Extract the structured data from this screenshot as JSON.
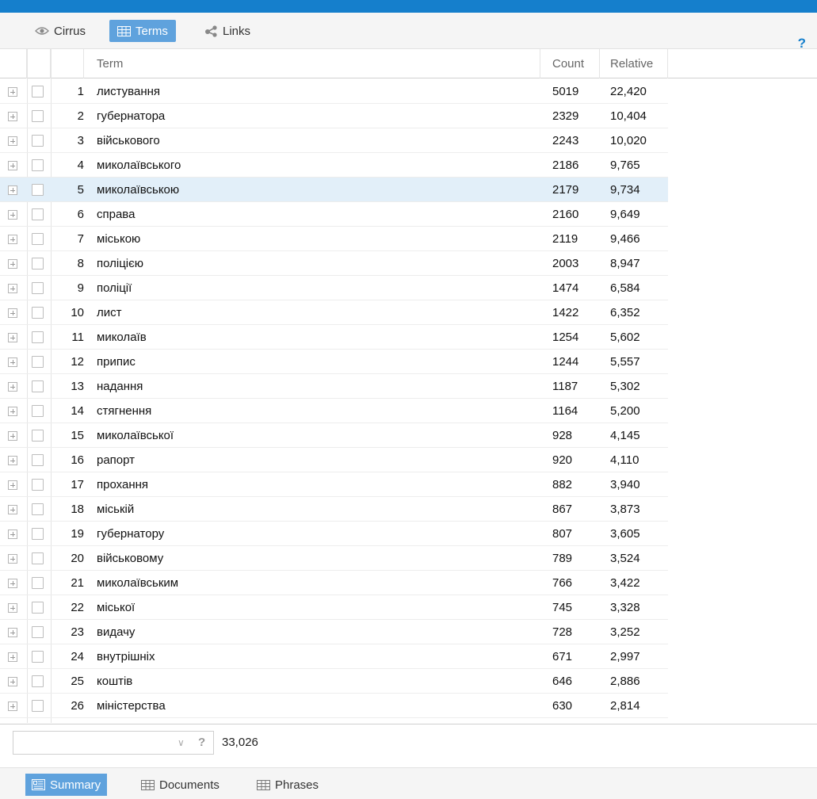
{
  "colors": {
    "accent": "#157fcc",
    "tab_active": "#5fa2dd",
    "row_selected": "#e2eff9"
  },
  "top_tabs": [
    {
      "label": "Cirrus",
      "icon": "eye-icon"
    },
    {
      "label": "Terms",
      "icon": "grid-icon",
      "active": true
    },
    {
      "label": "Links",
      "icon": "share-icon"
    }
  ],
  "help_label": "?",
  "columns": {
    "term": "Term",
    "count": "Count",
    "relative": "Relative"
  },
  "rows": [
    {
      "n": "1",
      "term": "листування",
      "count": "5019",
      "relative": "22,420"
    },
    {
      "n": "2",
      "term": "губернатора",
      "count": "2329",
      "relative": "10,404"
    },
    {
      "n": "3",
      "term": "військового",
      "count": "2243",
      "relative": "10,020"
    },
    {
      "n": "4",
      "term": "миколаївського",
      "count": "2186",
      "relative": "9,765"
    },
    {
      "n": "5",
      "term": "миколаївською",
      "count": "2179",
      "relative": "9,734",
      "selected": true
    },
    {
      "n": "6",
      "term": "справа",
      "count": "2160",
      "relative": "9,649"
    },
    {
      "n": "7",
      "term": "міською",
      "count": "2119",
      "relative": "9,466"
    },
    {
      "n": "8",
      "term": "поліцією",
      "count": "2003",
      "relative": "8,947"
    },
    {
      "n": "9",
      "term": "поліції",
      "count": "1474",
      "relative": "6,584"
    },
    {
      "n": "10",
      "term": "лист",
      "count": "1422",
      "relative": "6,352"
    },
    {
      "n": "11",
      "term": "миколаїв",
      "count": "1254",
      "relative": "5,602"
    },
    {
      "n": "12",
      "term": "припис",
      "count": "1244",
      "relative": "5,557"
    },
    {
      "n": "13",
      "term": "надання",
      "count": "1187",
      "relative": "5,302"
    },
    {
      "n": "14",
      "term": "стягнення",
      "count": "1164",
      "relative": "5,200"
    },
    {
      "n": "15",
      "term": "миколаївської",
      "count": "928",
      "relative": "4,145"
    },
    {
      "n": "16",
      "term": "рапорт",
      "count": "920",
      "relative": "4,110"
    },
    {
      "n": "17",
      "term": "прохання",
      "count": "882",
      "relative": "3,940"
    },
    {
      "n": "18",
      "term": "міській",
      "count": "867",
      "relative": "3,873"
    },
    {
      "n": "19",
      "term": "губернатору",
      "count": "807",
      "relative": "3,605"
    },
    {
      "n": "20",
      "term": "військовому",
      "count": "789",
      "relative": "3,524"
    },
    {
      "n": "21",
      "term": "миколаївським",
      "count": "766",
      "relative": "3,422"
    },
    {
      "n": "22",
      "term": "міської",
      "count": "745",
      "relative": "3,328"
    },
    {
      "n": "23",
      "term": "видачу",
      "count": "728",
      "relative": "3,252"
    },
    {
      "n": "24",
      "term": "внутрішніх",
      "count": "671",
      "relative": "2,997"
    },
    {
      "n": "25",
      "term": "коштів",
      "count": "646",
      "relative": "2,886"
    },
    {
      "n": "26",
      "term": "міністерства",
      "count": "630",
      "relative": "2,814"
    }
  ],
  "footer": {
    "filter_value": "",
    "filter_help": "?",
    "total": "33,026"
  },
  "bottom_tabs": [
    {
      "label": "Summary",
      "icon": "summary-icon",
      "active": true
    },
    {
      "label": "Documents",
      "icon": "grid-icon"
    },
    {
      "label": "Phrases",
      "icon": "grid-icon"
    }
  ]
}
